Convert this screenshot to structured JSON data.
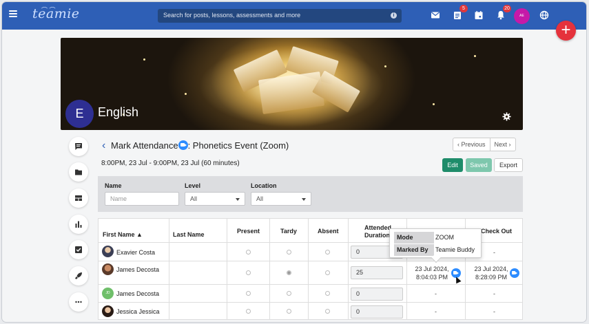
{
  "topbar": {
    "logo": "teamie",
    "search_placeholder": "Search for posts, lessons, assessments and more",
    "badge_posts": "5",
    "badge_notifications": "20",
    "avatar_initials": "AE"
  },
  "course": {
    "initial": "E",
    "name": "English"
  },
  "page": {
    "title_prefix": "Mark Attendance",
    "title_suffix": ": Phonetics Event (Zoom)",
    "datetime": "8:00PM, 23 Jul - 9:00PM, 23 Jul (60 minutes)",
    "prev": "‹ Previous",
    "next": "Next ›",
    "edit": "Edit",
    "saved": "Saved",
    "export": "Export"
  },
  "filters": {
    "name_label": "Name",
    "name_placeholder": "Name",
    "level_label": "Level",
    "level_value": "All",
    "location_label": "Location",
    "location_value": "All"
  },
  "table": {
    "headers": {
      "first_name": "First Name ▲",
      "last_name": "Last Name",
      "present": "Present",
      "tardy": "Tardy",
      "absent": "Absent",
      "attended_1": "Attended",
      "attended_2": "Duration",
      "check_out": "Check Out"
    },
    "rows": [
      {
        "name": "Exavier Costa",
        "status": "none",
        "duration": "0",
        "check_in": "-",
        "check_out": "-"
      },
      {
        "name": "James Decosta",
        "status": "tardy",
        "duration": "25",
        "check_in_1": "23 Jul 2024,",
        "check_in_2": "8:04:03 PM",
        "check_out_1": "23 Jul 2024,",
        "check_out_2": "8:28:09 PM"
      },
      {
        "name": "James Decosta",
        "initials": "JD",
        "status": "none",
        "duration": "0",
        "check_in": "-",
        "check_out": "-"
      },
      {
        "name": "Jessica Jessica",
        "status": "none",
        "duration": "0",
        "check_in": "-",
        "check_out": "-"
      }
    ]
  },
  "tooltip": {
    "mode_label": "Mode",
    "mode_value": "ZOOM",
    "marked_label": "Marked By",
    "marked_value": "Teamie Buddy"
  },
  "colors": {
    "topbar": "#2e5fb6",
    "edit_button": "#1e8c6a",
    "saved_button": "#7ec7ad",
    "fab": "#e5323c",
    "zoom": "#2d8cff"
  }
}
